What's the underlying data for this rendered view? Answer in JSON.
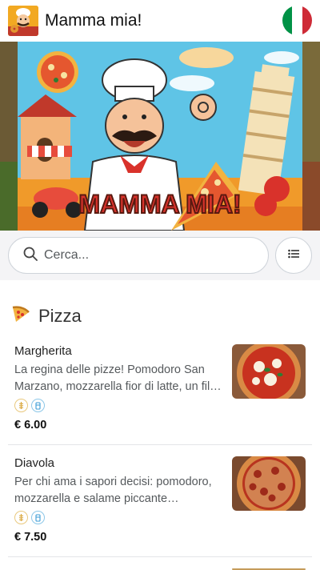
{
  "header": {
    "title": "Mamma mia!",
    "logo_icon": "chef-pizza-logo",
    "flag_icon": "italian-flag-icon",
    "flag_colors": [
      "#009246",
      "#ffffff",
      "#ce2b37"
    ]
  },
  "hero": {
    "banner_text": "MAMMA MIA!",
    "image": "cartoon-chef-banner"
  },
  "search": {
    "placeholder": "Cerca...",
    "value": "",
    "icon": "search-icon",
    "list_icon": "list-icon"
  },
  "category": {
    "title": "Pizza",
    "icon": "pizza-slice-icon"
  },
  "items": [
    {
      "name": "Margherita",
      "description": "La regina delle pizze! Pomodoro San Marzano, mozzarella fior di latte, un fil…",
      "tags": [
        "gluten-icon",
        "dairy-icon"
      ],
      "price": "€ 6.00",
      "image": "margherita-pizza-photo"
    },
    {
      "name": "Diavola",
      "description": "Per chi ama i sapori decisi: pomodoro, mozzarella e salame piccante…",
      "tags": [
        "gluten-icon",
        "dairy-icon"
      ],
      "price": "€ 7.50",
      "image": "diavola-pizza-photo"
    }
  ]
}
